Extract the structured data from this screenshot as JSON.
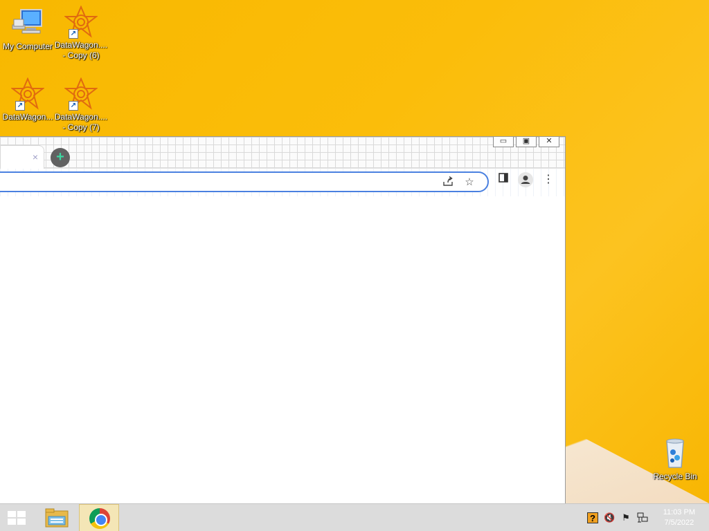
{
  "desktop": {
    "icons": [
      {
        "label": "My Computer",
        "icon": "computer-icon"
      },
      {
        "label": "DataWagon.... - Copy (6)",
        "icon": "datawagon-icon"
      },
      {
        "label": "DataWagon...",
        "icon": "datawagon-icon"
      },
      {
        "label": "DataWagon.... - Copy (7)",
        "icon": "datawagon-icon"
      },
      {
        "label": "Recycle Bin",
        "icon": "recycle-bin-icon"
      }
    ]
  },
  "browser": {
    "tab_close": "×",
    "new_tab": "+",
    "window_controls": {
      "minimize": "▭",
      "restore": "▣",
      "close": "✕"
    },
    "omnibox": {
      "value": ""
    },
    "toolbar_icons": [
      "share-icon",
      "bookmark-star-icon",
      "side-panel-icon",
      "profile-icon",
      "menu-icon"
    ]
  },
  "taskbar": {
    "apps": [
      "start-button",
      "file-explorer",
      "chrome"
    ],
    "clock": {
      "time": "11:03 PM",
      "date": "7/5/2022"
    }
  },
  "colors": {
    "desktop": "#f8b800",
    "accent": "#4a80e0",
    "taskbar": "#dcdcdc"
  }
}
